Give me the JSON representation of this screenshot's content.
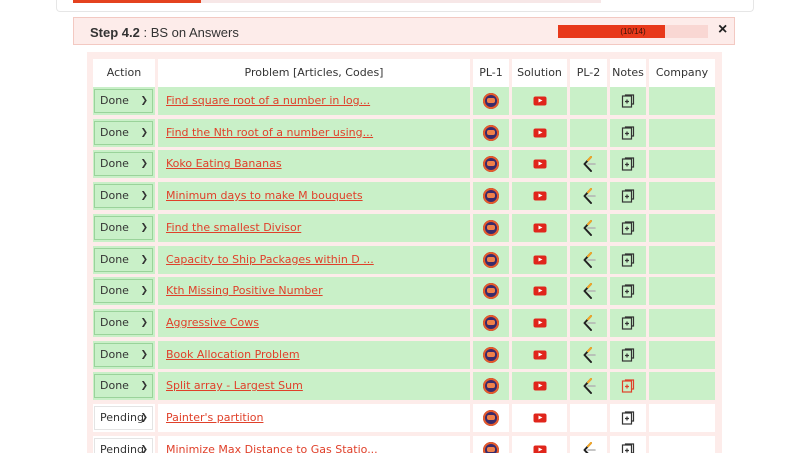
{
  "step": {
    "label": "Step 4.2",
    "separator": " : ",
    "title": "BS on Answers",
    "progress_text": "(10/14)",
    "progress_fraction": 0.714,
    "close": "×"
  },
  "columns": [
    "Action",
    "Problem [Articles, Codes]",
    "PL-1",
    "Solution",
    "PL-2",
    "Notes",
    "Company"
  ],
  "colors": {
    "accent": "#e4421f",
    "done_row": "#c9f0c8",
    "panel": "#fdecea",
    "link": "#e0402a"
  },
  "rows": [
    {
      "action": "Done",
      "problem": "Find square root of a number in log...",
      "pl2": false,
      "notes_active": false
    },
    {
      "action": "Done",
      "problem": "Find the Nth root of a number using...",
      "pl2": false,
      "notes_active": false
    },
    {
      "action": "Done",
      "problem": "Koko Eating Bananas",
      "pl2": true,
      "notes_active": false
    },
    {
      "action": "Done",
      "problem": "Minimum days to make M bouquets",
      "pl2": true,
      "notes_active": false
    },
    {
      "action": "Done",
      "problem": "Find the smallest Divisor",
      "pl2": true,
      "notes_active": false
    },
    {
      "action": "Done",
      "problem": "Capacity to Ship Packages within D ...",
      "pl2": true,
      "notes_active": false
    },
    {
      "action": "Done",
      "problem": "Kth Missing Positive Number",
      "pl2": true,
      "notes_active": false
    },
    {
      "action": "Done",
      "problem": "Aggressive Cows",
      "pl2": true,
      "notes_active": false
    },
    {
      "action": "Done",
      "problem": "Book Allocation Problem",
      "pl2": true,
      "notes_active": false
    },
    {
      "action": "Done",
      "problem": "Split array - Largest Sum",
      "pl2": true,
      "notes_active": true
    },
    {
      "action": "Pending",
      "problem": "Painter's partition",
      "pl2": false,
      "notes_active": false
    },
    {
      "action": "Pending",
      "problem": "Minimize Max Distance to Gas Statio...",
      "pl2": true,
      "notes_active": false
    }
  ]
}
